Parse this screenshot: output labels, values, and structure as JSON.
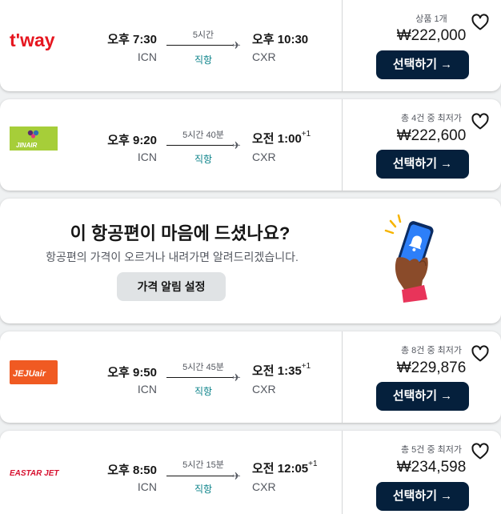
{
  "flights": [
    {
      "airline": "t'way",
      "depart_time": "오후 7:30",
      "depart_code": "ICN",
      "duration": "5시간",
      "stops": "직항",
      "arrive_time": "오후 10:30",
      "arrive_offset": "",
      "arrive_code": "CXR",
      "sub_label": "상품 1개",
      "price": "₩222,000",
      "select_label": "선택하기 →"
    },
    {
      "airline": "JINAIR",
      "depart_time": "오후 9:20",
      "depart_code": "ICN",
      "duration": "5시간 40분",
      "stops": "직항",
      "arrive_time": "오전 1:00",
      "arrive_offset": "+1",
      "arrive_code": "CXR",
      "sub_label": "총 4건 중 최저가",
      "price": "₩222,600",
      "select_label": "선택하기 →"
    },
    {
      "airline": "JEJUair",
      "depart_time": "오후 9:50",
      "depart_code": "ICN",
      "duration": "5시간 45분",
      "stops": "직항",
      "arrive_time": "오전 1:35",
      "arrive_offset": "+1",
      "arrive_code": "CXR",
      "sub_label": "총 8건 중 최저가",
      "price": "₩229,876",
      "select_label": "선택하기 →"
    },
    {
      "airline": "EASTAR JET",
      "depart_time": "오후 8:50",
      "depart_code": "ICN",
      "duration": "5시간 15분",
      "stops": "직항",
      "arrive_time": "오전 12:05",
      "arrive_offset": "+1",
      "arrive_code": "CXR",
      "sub_label": "총 5건 중 최저가",
      "price": "₩234,598",
      "select_label": "선택하기 →"
    }
  ],
  "price_alert": {
    "title": "이 항공편이 마음에 드셨나요?",
    "description": "항공편의 가격이 오르거나 내려가면 알려드리겠습니다.",
    "button_label": "가격 알림 설정"
  },
  "colors": {
    "select_button": "#05203c",
    "direct_text": "#0c838a",
    "tway_red": "#e6161f",
    "jinair_green": "#a6ce39",
    "jeju_orange": "#f05a22",
    "eastar_red": "#d7102f"
  }
}
